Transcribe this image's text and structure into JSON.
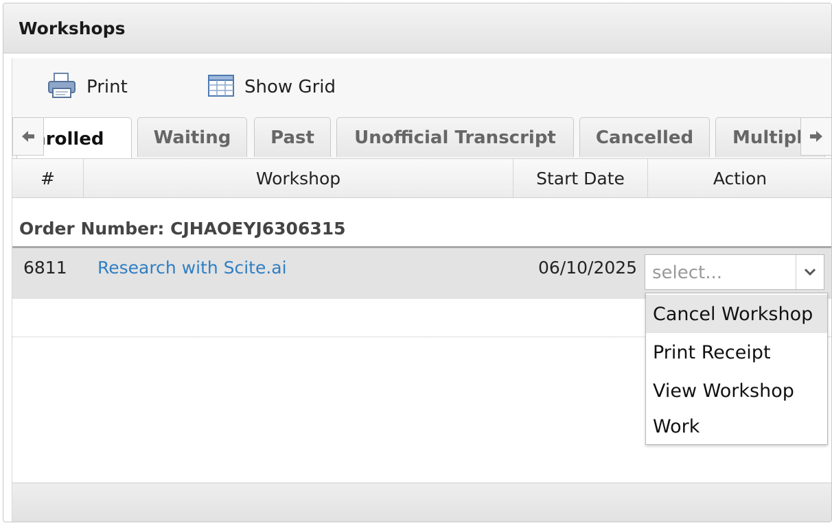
{
  "panel": {
    "title": "Workshops"
  },
  "toolbar": {
    "print_label": "Print",
    "show_grid_label": "Show Grid"
  },
  "tabs": [
    {
      "label": "Enrolled",
      "active": true
    },
    {
      "label": "Waiting"
    },
    {
      "label": "Past"
    },
    {
      "label": "Unofficial Transcript"
    },
    {
      "label": "Cancelled"
    },
    {
      "label": "Multiple"
    }
  ],
  "grid": {
    "columns": [
      "#",
      "Workshop",
      "Start Date",
      "Action"
    ],
    "group_label": "Order Number: CJHAOEYJ6306315",
    "rows": [
      {
        "number": "6811",
        "workshop": "Research with Scite.ai",
        "start_date": "06/10/2025",
        "action_placeholder": "select..."
      }
    ]
  },
  "action_dropdown": {
    "options": [
      "Cancel Workshop",
      "Print Receipt",
      "View Workshop",
      "Work"
    ],
    "highlighted": "Cancel Workshop"
  },
  "colors": {
    "link": "#2f7fc4",
    "row_bg": "#e3e3e3"
  }
}
